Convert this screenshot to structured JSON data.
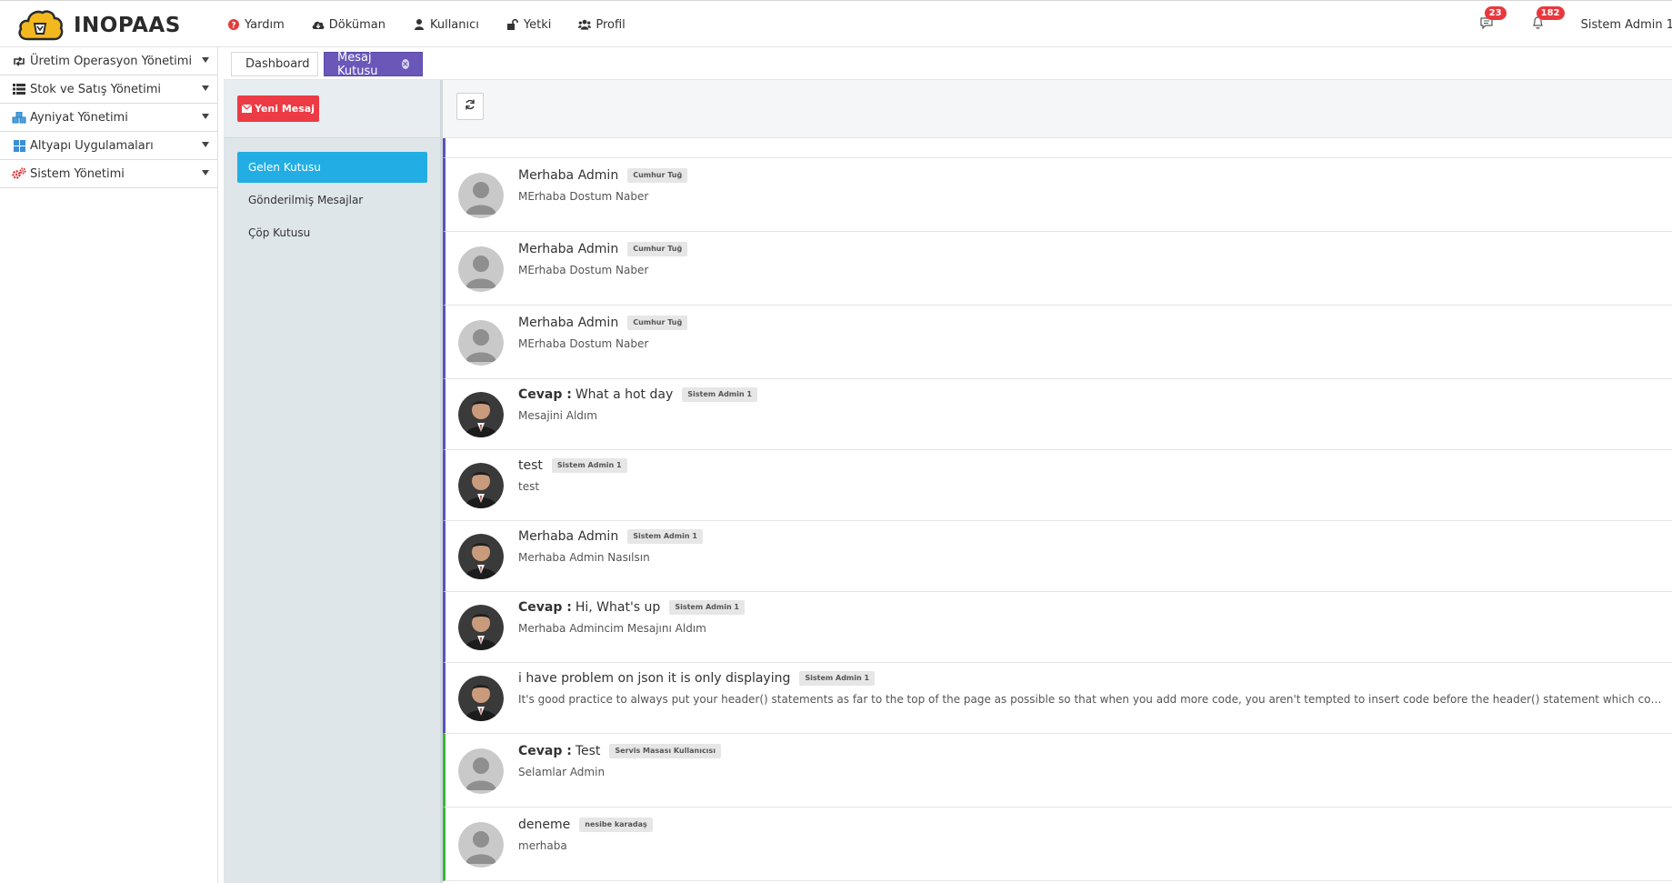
{
  "app": {
    "name": "INOPAAS"
  },
  "topnav": [
    {
      "label": "Yardım",
      "icon": "question-circle-icon"
    },
    {
      "label": "Döküman",
      "icon": "cloud-download-icon"
    },
    {
      "label": "Kullanıcı",
      "icon": "user-icon"
    },
    {
      "label": "Yetki",
      "icon": "unlock-icon"
    },
    {
      "label": "Profil",
      "icon": "users-icon"
    }
  ],
  "notifications": {
    "messages": "23",
    "alerts": "182"
  },
  "user": {
    "name": "Sistem Admin 1"
  },
  "sidebar": {
    "items": [
      {
        "label": "Üretim Operasyon Yönetimi",
        "icon": "retweet-icon"
      },
      {
        "label": "Stok ve Satış Yönetimi",
        "icon": "list-icon"
      },
      {
        "label": "Ayniyat Yönetimi",
        "icon": "cubes-icon"
      },
      {
        "label": "Altyapı Uygulamaları",
        "icon": "th-large-icon"
      },
      {
        "label": "Sistem Yönetimi",
        "icon": "cogs-icon"
      }
    ]
  },
  "tabs": {
    "dashboard": "Dashboard",
    "active": "Mesaj Kutusu"
  },
  "mailbox": {
    "new_message": "Yeni Mesaj",
    "folders": [
      "Gelen Kutusu",
      "Gönderilmiş Mesajlar",
      "Çöp Kutusu"
    ]
  },
  "messages": [
    {
      "prefix": "",
      "title": "Merhaba Admin",
      "sender": "Cumhur Tuğ",
      "body": "MErhaba Dostum Naber",
      "avatar": "placeholder",
      "border": "purple"
    },
    {
      "prefix": "",
      "title": "Merhaba Admin",
      "sender": "Cumhur Tuğ",
      "body": "MErhaba Dostum Naber",
      "avatar": "placeholder",
      "border": "purple"
    },
    {
      "prefix": "",
      "title": "Merhaba Admin",
      "sender": "Cumhur Tuğ",
      "body": "MErhaba Dostum Naber",
      "avatar": "placeholder",
      "border": "purple"
    },
    {
      "prefix": "Cevap :",
      "title": "What a hot day",
      "sender": "Sistem Admin 1",
      "body": "Mesajini Aldım",
      "avatar": "photo",
      "border": "purple"
    },
    {
      "prefix": "",
      "title": "test",
      "sender": "Sistem Admin 1",
      "body": "test",
      "avatar": "photo",
      "border": "purple"
    },
    {
      "prefix": "",
      "title": "Merhaba Admin",
      "sender": "Sistem Admin 1",
      "body": "Merhaba Admin Nasılsın",
      "avatar": "photo",
      "border": "purple"
    },
    {
      "prefix": "Cevap :",
      "title": "Hi, What's up",
      "sender": "Sistem Admin 1",
      "body": "Merhaba Admincim Mesajını Aldım",
      "avatar": "photo",
      "border": "purple"
    },
    {
      "prefix": "",
      "title": "i have problem on json it is only displaying",
      "sender": "Sistem Admin 1",
      "body": "It's good practice to always put your header() statements as far to the top of the page as possible so that when you add more code, you aren't tempted to insert code before the header() statement which could break things if you start outputting content before it.",
      "avatar": "photo",
      "border": "purple"
    },
    {
      "prefix": "Cevap :",
      "title": "Test",
      "sender": "Servis Masası Kullanıcısı",
      "body": "Selamlar Admin",
      "avatar": "placeholder",
      "border": "green"
    },
    {
      "prefix": "",
      "title": "deneme",
      "sender": "nesibe karadaş",
      "body": "merhaba",
      "avatar": "placeholder",
      "border": "green"
    }
  ],
  "colors": {
    "accent": "#6a57b8",
    "folder_active": "#22aee4",
    "new_button": "#ec3b44",
    "badge": "#e8383d"
  }
}
